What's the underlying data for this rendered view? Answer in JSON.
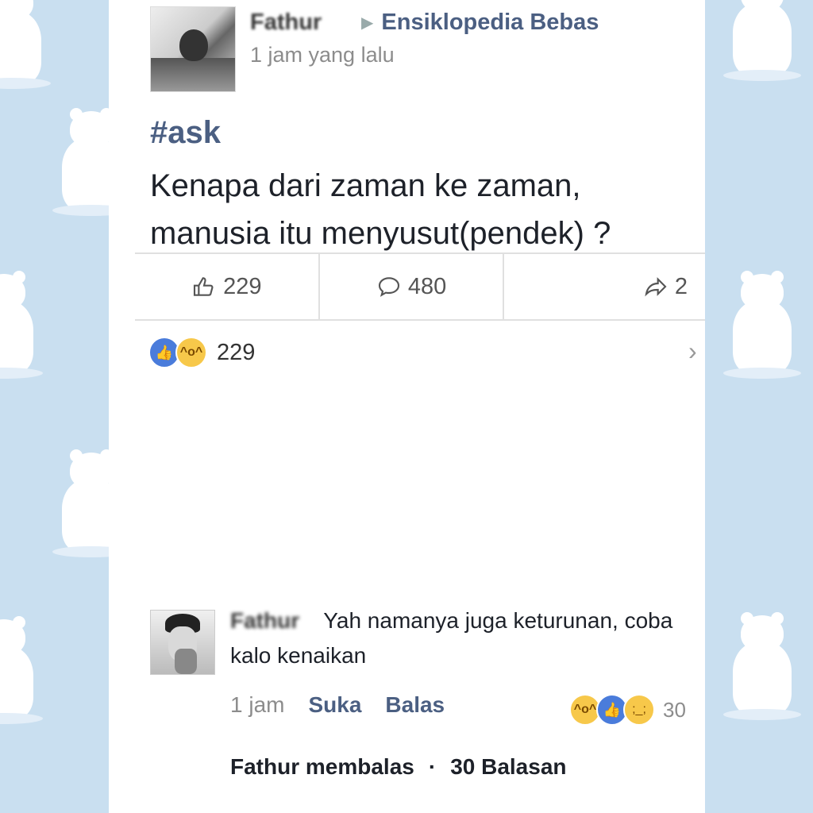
{
  "post": {
    "author": "Fathur",
    "group": "Ensiklopedia Bebas",
    "time": "1 jam yang lalu",
    "hashtag": "#ask",
    "line1": "Kenapa dari zaman ke zaman,",
    "line2": "manusia itu menyusut(pendek) ?"
  },
  "stats": {
    "likes": "229",
    "comments": "480",
    "shares": "2"
  },
  "reactions": {
    "count": "229"
  },
  "comment": {
    "author": "Fathur",
    "text_line1": "Yah namanya juga keturunan, coba",
    "text_line2": "kalo kenaikan",
    "time": "1 jam",
    "like_label": "Suka",
    "reply_label": "Balas",
    "reaction_count": "30"
  },
  "replies": {
    "replier": "Fathur membalas",
    "separator": "·",
    "count_label": "30 Balasan"
  },
  "colors": {
    "background": "#c9dff0",
    "link": "#4b5f82",
    "like_blue": "#4a7cdb",
    "emoji_yellow": "#f7c84a"
  }
}
